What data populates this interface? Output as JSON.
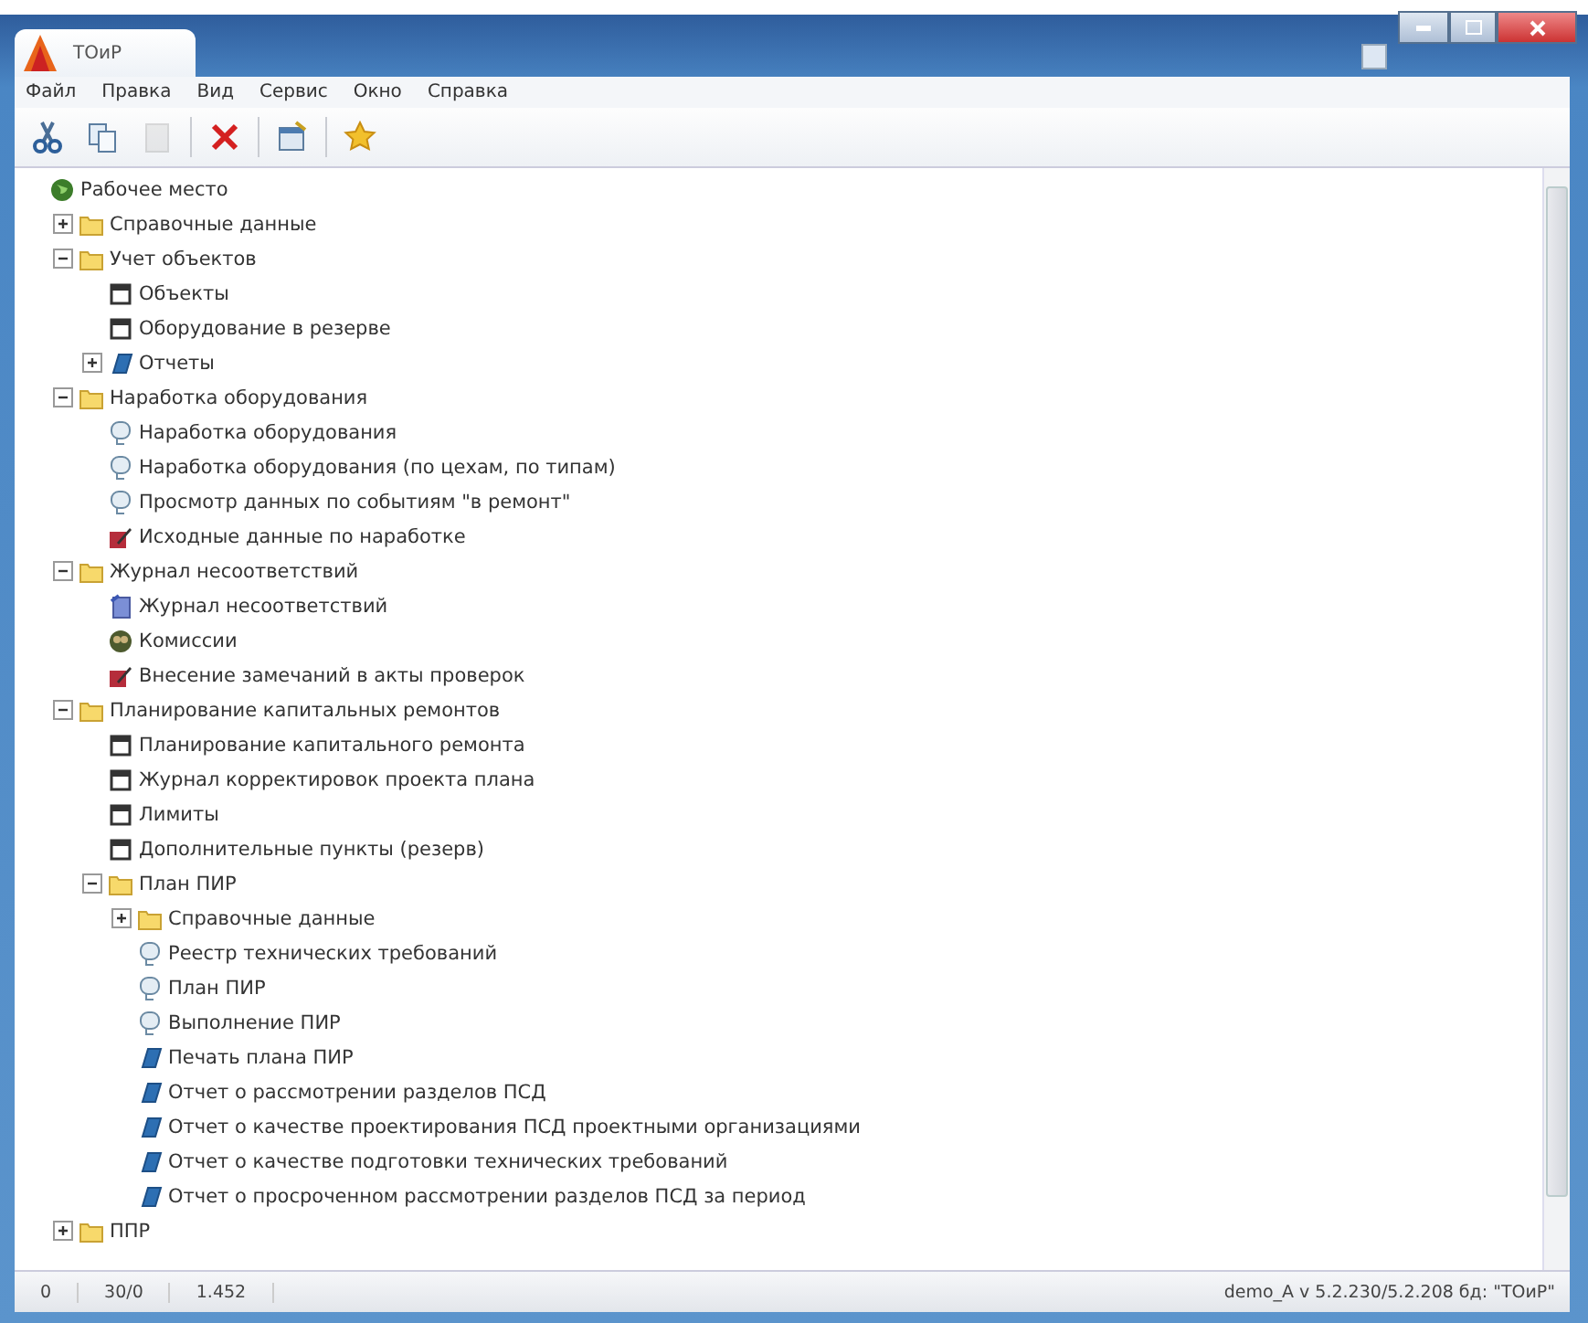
{
  "window": {
    "tab_title": "ТОиР"
  },
  "menu": [
    "Файл",
    "Правка",
    "Вид",
    "Сервис",
    "Окно",
    "Справка"
  ],
  "toolbar": [
    {
      "kind": "cut",
      "disabled": false
    },
    {
      "kind": "copy",
      "disabled": false
    },
    {
      "kind": "paste",
      "disabled": true
    },
    {
      "kind": "sep"
    },
    {
      "kind": "delete",
      "disabled": false
    },
    {
      "kind": "sep"
    },
    {
      "kind": "properties",
      "disabled": false
    },
    {
      "kind": "sep"
    },
    {
      "kind": "favorite",
      "disabled": false
    }
  ],
  "tree": [
    {
      "label": "Рабочее место",
      "kind": "root",
      "children": [
        {
          "label": "Справочные данные",
          "kind": "folder",
          "expanded": false
        },
        {
          "label": "Учет объектов",
          "kind": "folder",
          "expanded": true,
          "children": [
            {
              "label": "Объекты",
              "kind": "form"
            },
            {
              "label": "Оборудование в резерве",
              "kind": "form"
            },
            {
              "label": "Отчеты",
              "kind": "report",
              "expanded": false
            }
          ]
        },
        {
          "label": "Наработка оборудования",
          "kind": "folder",
          "expanded": true,
          "children": [
            {
              "label": "Наработка оборудования",
              "kind": "query"
            },
            {
              "label": "Наработка оборудования (по цехам, по типам)",
              "kind": "query"
            },
            {
              "label": "Просмотр данных по событиям \"в ремонт\"",
              "kind": "query"
            },
            {
              "label": "Исходные данные по наработке",
              "kind": "edit"
            }
          ]
        },
        {
          "label": "Журнал несоответствий",
          "kind": "folder",
          "expanded": true,
          "children": [
            {
              "label": "Журнал несоответствий",
              "kind": "journal"
            },
            {
              "label": "Комиссии",
              "kind": "commission"
            },
            {
              "label": "Внесение замечаний в акты проверок",
              "kind": "edit"
            }
          ]
        },
        {
          "label": "Планирование капитальных ремонтов",
          "kind": "folder",
          "expanded": true,
          "children": [
            {
              "label": "Планирование капитального ремонта",
              "kind": "form"
            },
            {
              "label": "Журнал корректировок проекта плана",
              "kind": "form"
            },
            {
              "label": "Лимиты",
              "kind": "form"
            },
            {
              "label": "Дополнительные пункты (резерв)",
              "kind": "form"
            },
            {
              "label": "План ПИР",
              "kind": "folder",
              "expanded": true,
              "children": [
                {
                  "label": "Справочные данные",
                  "kind": "folder",
                  "expanded": false
                },
                {
                  "label": "Реестр технических требований",
                  "kind": "query"
                },
                {
                  "label": "План ПИР",
                  "kind": "query"
                },
                {
                  "label": "Выполнение ПИР",
                  "kind": "query"
                },
                {
                  "label": "Печать плана ПИР",
                  "kind": "report"
                },
                {
                  "label": "Отчет о рассмотрении разделов ПСД",
                  "kind": "report"
                },
                {
                  "label": "Отчет о качестве проектирования ПСД проектными организациями",
                  "kind": "report"
                },
                {
                  "label": "Отчет о качестве подготовки технических требований",
                  "kind": "report"
                },
                {
                  "label": "Отчет о просроченном рассмотрении разделов ПСД за период",
                  "kind": "report"
                }
              ]
            }
          ]
        },
        {
          "label": "ППР",
          "kind": "folder",
          "expanded": false
        }
      ]
    }
  ],
  "status_bar": [
    "0",
    "30/0",
    "1.452"
  ],
  "status_info": "demo_A  v 5.2.230/5.2.208 бд: \"ТОиР\""
}
